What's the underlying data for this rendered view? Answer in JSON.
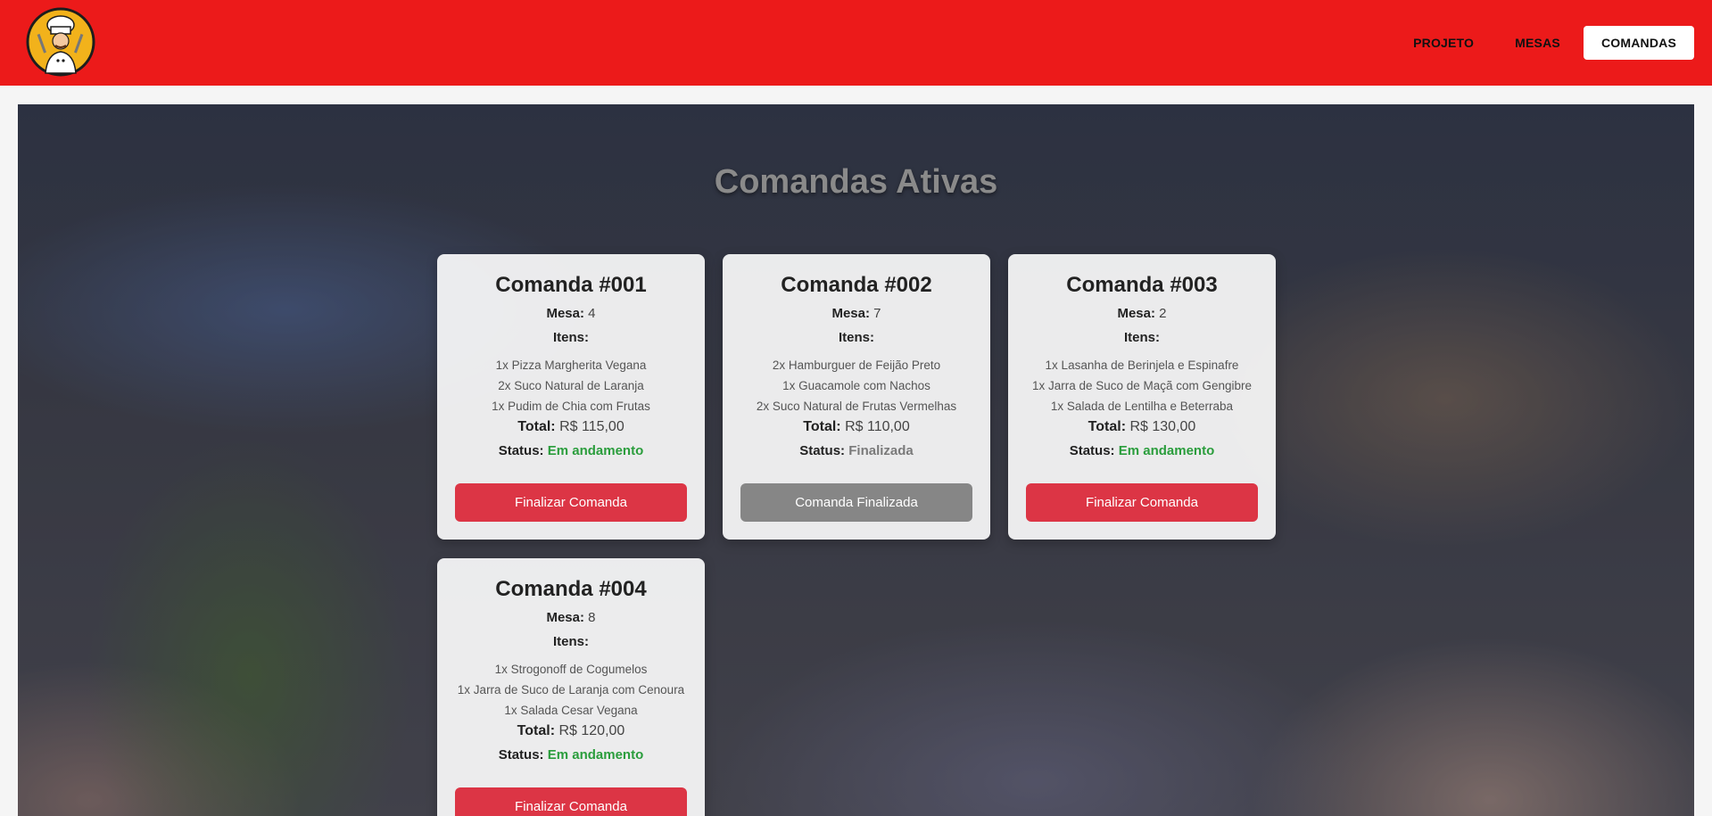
{
  "header": {
    "logo_alt": "Chef logo",
    "nav": [
      {
        "label": "PROJETO",
        "active": false
      },
      {
        "label": "MESAS",
        "active": false
      },
      {
        "label": "COMANDAS",
        "active": true
      }
    ]
  },
  "page": {
    "title": "Comandas Ativas"
  },
  "labels": {
    "mesa": "Mesa:",
    "itens": "Itens:",
    "total": "Total:",
    "status": "Status:"
  },
  "comandas": [
    {
      "title": "Comanda #001",
      "mesa": "4",
      "items": [
        "1x Pizza Margherita Vegana",
        "2x Suco Natural de Laranja",
        "1x Pudim de Chia com Frutas"
      ],
      "total": "R$ 115,00",
      "status": "Em andamento",
      "status_color": "#2a9d3c",
      "button": "Finalizar Comanda",
      "button_color": "#dc3545"
    },
    {
      "title": "Comanda #002",
      "mesa": "7",
      "items": [
        "2x Hamburguer de Feijão Preto",
        "1x Guacamole com Nachos",
        "2x Suco Natural de Frutas Vermelhas"
      ],
      "total": "R$ 110,00",
      "status": "Finalizada",
      "status_color": "#7a7a7a",
      "button": "Comanda Finalizada",
      "button_color": "#868686"
    },
    {
      "title": "Comanda #003",
      "mesa": "2",
      "items": [
        "1x Lasanha de Berinjela e Espinafre",
        "1x Jarra de Suco de Maçã com Gengibre",
        "1x Salada de Lentilha e Beterraba"
      ],
      "total": "R$ 130,00",
      "status": "Em andamento",
      "status_color": "#2a9d3c",
      "button": "Finalizar Comanda",
      "button_color": "#dc3545"
    },
    {
      "title": "Comanda #004",
      "mesa": "8",
      "items": [
        "1x Strogonoff de Cogumelos",
        "1x Jarra de Suco de Laranja com Cenoura",
        "1x Salada Cesar Vegana"
      ],
      "total": "R$ 120,00",
      "status": "Em andamento",
      "status_color": "#2a9d3c",
      "button": "Finalizar Comanda",
      "button_color": "#dc3545"
    }
  ]
}
